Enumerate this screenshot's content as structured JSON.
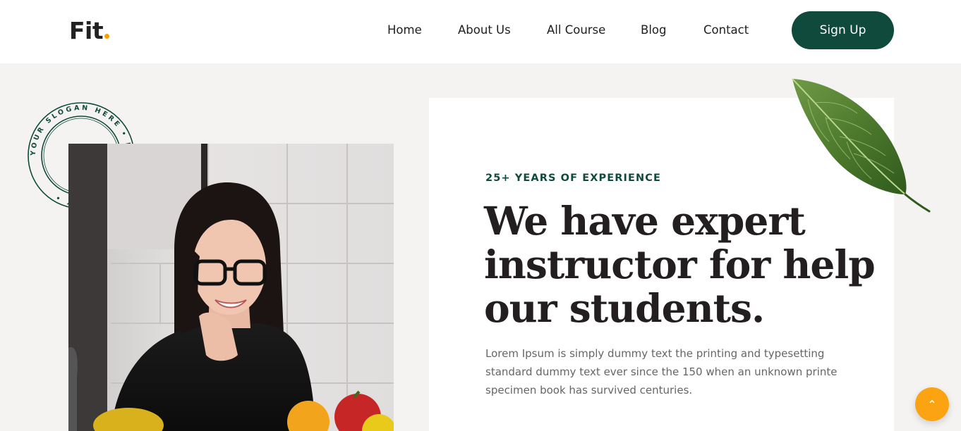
{
  "brand": {
    "name": "Fit",
    "accent_dot_color": "#f5a200"
  },
  "nav": {
    "items": [
      {
        "label": "Home"
      },
      {
        "label": "About Us"
      },
      {
        "label": "All Course"
      },
      {
        "label": "Blog"
      },
      {
        "label": "Contact"
      }
    ],
    "signup_label": "Sign Up"
  },
  "stamp": {
    "text": "YOUR SLOGAN HERE • NATURAL BEAUTY •"
  },
  "hero": {
    "eyebrow": "25+ YEARS OF EXPERIENCE",
    "headline_lines": [
      "We have expert",
      "instructor for help",
      "our students."
    ],
    "paragraph": "Lorem Ipsum is simply dummy text the printing and typesetting standard dummy text ever since the 150 when an unknown printe specimen book has survived centuries."
  },
  "photo": {
    "icon": "woman-smiling-photo"
  },
  "scroll_top": {
    "icon": "chevron-up-icon",
    "glyph": "⌃"
  },
  "colors": {
    "primary_green": "#0f4a3c",
    "accent_orange": "#fca311",
    "leaf_green": "#4e7a2e",
    "page_bg": "#f4f3f1"
  }
}
